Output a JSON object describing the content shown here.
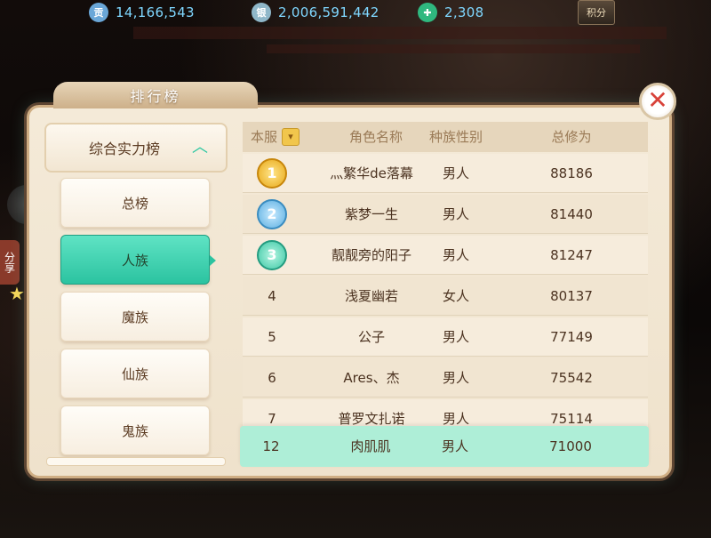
{
  "resources": [
    {
      "icon": "gong-icon",
      "glyph": "贡",
      "value": "14,166,543",
      "color": "#6aa7d8"
    },
    {
      "icon": "silver-icon",
      "glyph": "银",
      "value": "2,006,591,442",
      "color": "#8fb7c9"
    },
    {
      "icon": "jade-icon",
      "glyph": "✚",
      "value": "2,308",
      "color": "#2fb87f"
    }
  ],
  "score_button": "积分",
  "share_label": "分享",
  "panel_title": "排行榜",
  "close_glyph": "✕",
  "category_header": {
    "label": "综合实力榜",
    "chevron": "︿"
  },
  "categories": [
    {
      "label": "总榜",
      "active": false
    },
    {
      "label": "人族",
      "active": true
    },
    {
      "label": "魔族",
      "active": false
    },
    {
      "label": "仙族",
      "active": false
    },
    {
      "label": "鬼族",
      "active": false
    }
  ],
  "table": {
    "headers": {
      "server": "本服",
      "server_arrow": "▾",
      "name": "角色名称",
      "gender": "种族性别",
      "score": "总修为"
    },
    "rows": [
      {
        "rank": "1",
        "name": "灬繁华de落幕",
        "gender": "男人",
        "score": "88186"
      },
      {
        "rank": "2",
        "name": "紫梦一生",
        "gender": "男人",
        "score": "81440"
      },
      {
        "rank": "3",
        "name": "靓靓旁的阳子",
        "gender": "男人",
        "score": "81247"
      },
      {
        "rank": "4",
        "name": "浅夏幽若",
        "gender": "女人",
        "score": "80137"
      },
      {
        "rank": "5",
        "name": "公子",
        "gender": "男人",
        "score": "77149"
      },
      {
        "rank": "6",
        "name": "Ares、杰",
        "gender": "男人",
        "score": "75542"
      },
      {
        "rank": "7",
        "name": "普罗文扎诺",
        "gender": "男人",
        "score": "75114"
      }
    ],
    "self_row": {
      "rank": "12",
      "name": "肉肌肌",
      "gender": "男人",
      "score": "71000"
    }
  }
}
